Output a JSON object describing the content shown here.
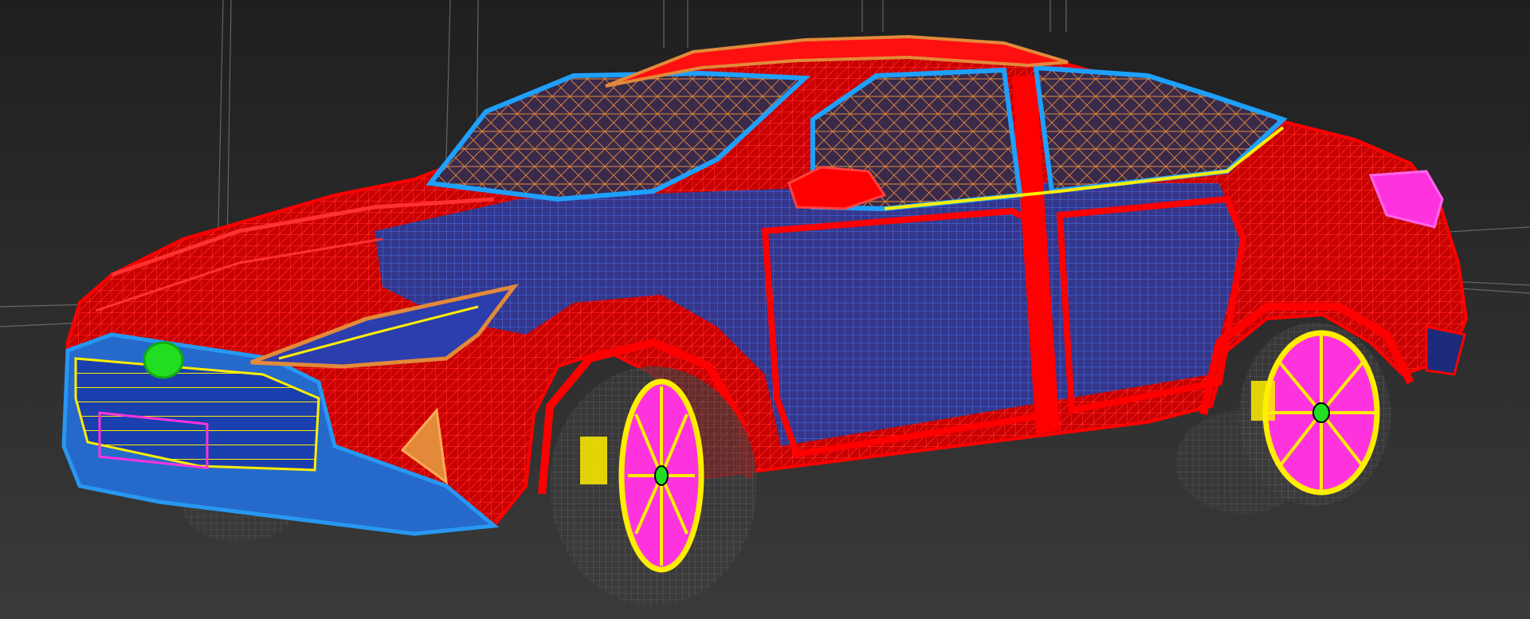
{
  "viewport": {
    "mode": "wireframe",
    "colors": {
      "background_top": "#1f1f1f",
      "background_bottom": "#3a3a3a",
      "grid_line": "#9a9a9a",
      "body_wire": "#ff0000",
      "glass_wire": "#e28a3a",
      "interior_wire": "#2a78ff",
      "trim_wire": "#1ea0ff",
      "accent_wire": "#ffee00",
      "wheel_face": "#ff33dd",
      "wheel_rim": "#ffee00",
      "emblem": "#22dd22",
      "tire_wire": "#888888"
    }
  },
  "object": {
    "name": "car",
    "wheels": 2
  }
}
